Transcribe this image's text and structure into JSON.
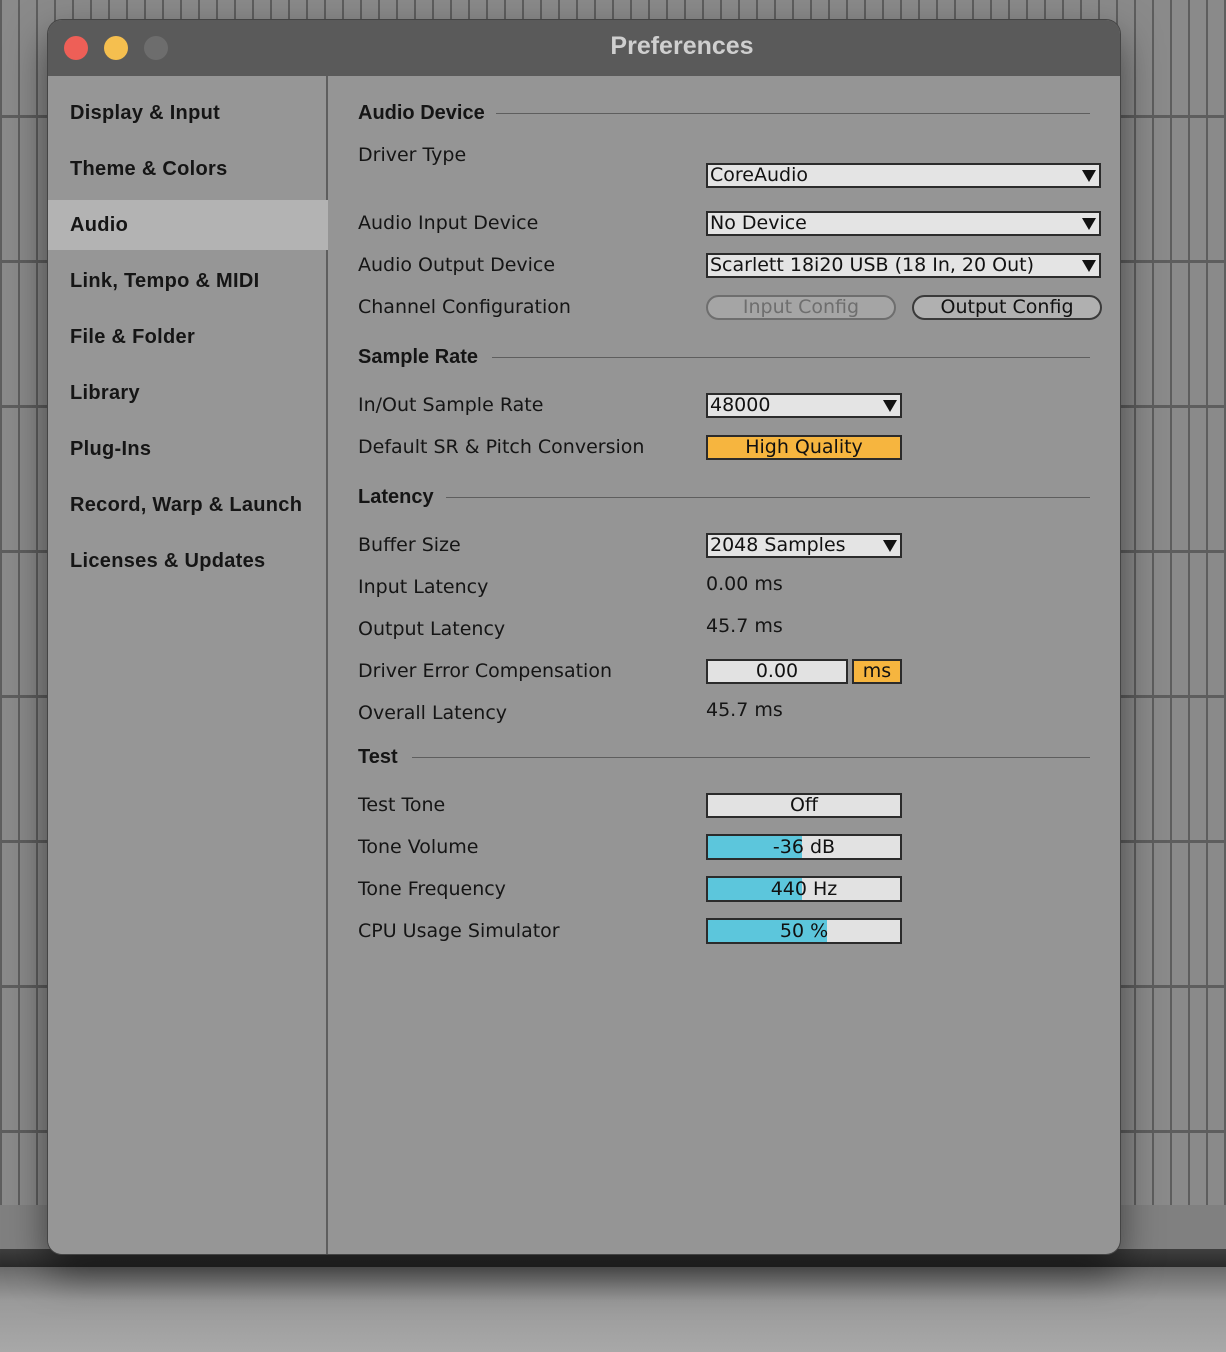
{
  "window": {
    "title": "Preferences"
  },
  "sidebar": {
    "items": [
      {
        "label": "Display & Input"
      },
      {
        "label": "Theme & Colors"
      },
      {
        "label": "Audio",
        "active": true
      },
      {
        "label": "Link, Tempo & MIDI"
      },
      {
        "label": "File & Folder"
      },
      {
        "label": "Library"
      },
      {
        "label": "Plug-Ins"
      },
      {
        "label": "Record, Warp & Launch"
      },
      {
        "label": "Licenses & Updates"
      }
    ]
  },
  "audio_device": {
    "heading": "Audio Device",
    "driver_type": {
      "label": "Driver Type",
      "value": "CoreAudio"
    },
    "input_device": {
      "label": "Audio Input Device",
      "value": "No Device"
    },
    "output_device": {
      "label": "Audio Output Device",
      "value": "Scarlett 18i20 USB (18 In, 20 Out)"
    },
    "channel_config": {
      "label": "Channel Configuration",
      "input_button": "Input Config",
      "output_button": "Output Config"
    }
  },
  "sample_rate": {
    "heading": "Sample Rate",
    "in_out": {
      "label": "In/Out Sample Rate",
      "value": "48000"
    },
    "conversion": {
      "label": "Default SR & Pitch Conversion",
      "value": "High Quality"
    }
  },
  "latency": {
    "heading": "Latency",
    "buffer_size": {
      "label": "Buffer Size",
      "value": "2048 Samples"
    },
    "input_latency": {
      "label": "Input Latency",
      "value": "0.00 ms"
    },
    "output_latency": {
      "label": "Output Latency",
      "value": "45.7 ms"
    },
    "driver_error": {
      "label": "Driver Error Compensation",
      "value": "0.00",
      "unit": "ms"
    },
    "overall_latency": {
      "label": "Overall Latency",
      "value": "45.7 ms"
    }
  },
  "test": {
    "heading": "Test",
    "test_tone": {
      "label": "Test Tone",
      "value": "Off"
    },
    "tone_volume": {
      "label": "Tone Volume",
      "value": "-36 dB",
      "level": 0.49
    },
    "tone_frequency": {
      "label": "Tone Frequency",
      "value": "440 Hz",
      "level": 0.49
    },
    "cpu_usage": {
      "label": "CPU Usage Simulator",
      "value": "50 %",
      "level": 0.62
    }
  },
  "colors": {
    "accent_orange": "#f6b53f",
    "slider_fill": "#5cc6dc",
    "close_button": "#ee5f57",
    "minimize_button": "#f5bf4f"
  }
}
